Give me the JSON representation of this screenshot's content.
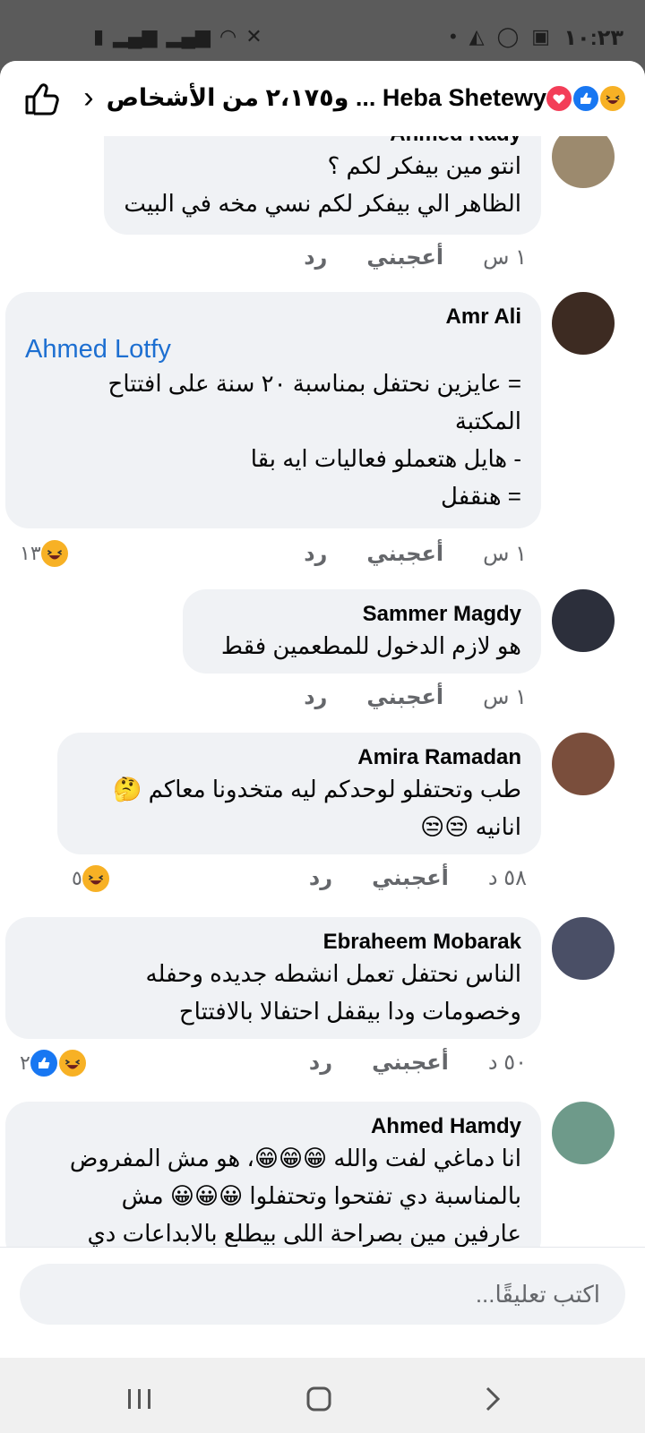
{
  "status_bar": {
    "time": "١٠:٢٣"
  },
  "header": {
    "title": "Heba Shetewy ... و٢،١٧٥ من الأشخاص",
    "reactions": [
      "haha-icon",
      "like-icon",
      "love-icon"
    ]
  },
  "comments": [
    {
      "author": "Ahmed Rady",
      "lines": [
        "انتو مين بيفكر لكم ؟",
        "الظاهر الي بيفكر لكم نسي مخه في البيت"
      ],
      "time": "١ س",
      "like": "أعجبني",
      "reply": "رد"
    },
    {
      "author": "Amr Ali",
      "tag": "Ahmed Lotfy",
      "lines": [
        "= عايزين نحتفل بمناسبة ٢٠ سنة على افتتاح",
        "المكتبة",
        "- هايل هتعملو فعاليات ايه بقا",
        "= هنقفل"
      ],
      "time": "١ س",
      "like": "أعجبني",
      "reply": "رد",
      "reaction_count": "١٣"
    },
    {
      "author": "Sammer Magdy",
      "lines": [
        "هو لازم  الدخول للمطعمين  فقط"
      ],
      "time": "١ س",
      "like": "أعجبني",
      "reply": "رد"
    },
    {
      "author": "Amira Ramadan",
      "lines": [
        "طب وتحتفلو لوحدكم ليه متخدونا معاكم 🤔",
        "انانيه 😒😒"
      ],
      "time": "٥٨ د",
      "like": "أعجبني",
      "reply": "رد",
      "reaction_count": "٥"
    },
    {
      "author": "Ebraheem Mobarak",
      "lines": [
        "الناس نحتفل تعمل انشطه جديده وحفله",
        "وخصومات ودا بيقفل احتفالا بالافتتاح"
      ],
      "time": "٥٠ د",
      "like": "أعجبني",
      "reply": "رد",
      "reaction_count": "٢"
    },
    {
      "author": "Ahmed Hamdy",
      "lines": [
        "انا دماغي لفت والله 😁😁😁، هو مش المفروض",
        "بالمناسبة دي تفتحوا وتحتفلوا 😀😀😀 مش",
        "عارفين مين بصراحة اللى بيطلع بالابداعات دي"
      ]
    }
  ],
  "composer": {
    "placeholder": "اكتب تعليقًا..."
  },
  "colors": {
    "bubble": "#f0f2f5",
    "link": "#1d6fd1",
    "like": "#1877f2",
    "haha": "#f7b125",
    "love": "#f33e58"
  }
}
